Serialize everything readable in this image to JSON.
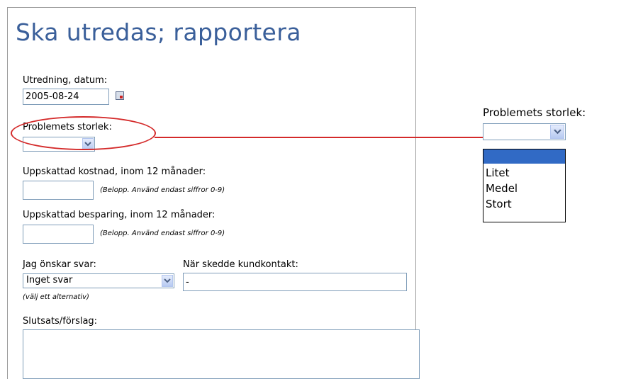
{
  "form": {
    "title": "Ska utredas; rapportera",
    "investigation_date_label": "Utredning, datum:",
    "investigation_date_value": "2005-08-24",
    "problem_size_label": "Problemets storlek:",
    "problem_size_value": "",
    "estimated_cost_label": "Uppskattad kostnad, inom 12 månader:",
    "estimated_cost_value": "",
    "amount_hint": "(Belopp. Använd endast siffror 0-9)",
    "estimated_saving_label": "Uppskattad besparing, inom 12 månader:",
    "estimated_saving_value": "",
    "amount_hint_2": "(Belopp. Använd endast siffror 0-9)",
    "reply_label": "Jag önskar svar:",
    "reply_value": "Inget svar",
    "reply_hint": "(välj ett alternativ)",
    "contact_label": "När skedde kundkontakt:",
    "contact_value": "-",
    "conclusion_label": "Slutsats/förslag:"
  },
  "callout": {
    "label": "Problemets storlek:",
    "selected_value": "",
    "options": [
      "",
      "Litet",
      "Medel",
      "Stort"
    ]
  },
  "colors": {
    "title": "#3a5f9a",
    "highlight": "#d42a2a",
    "selection": "#316ac5",
    "input_border": "#7f9db9"
  }
}
